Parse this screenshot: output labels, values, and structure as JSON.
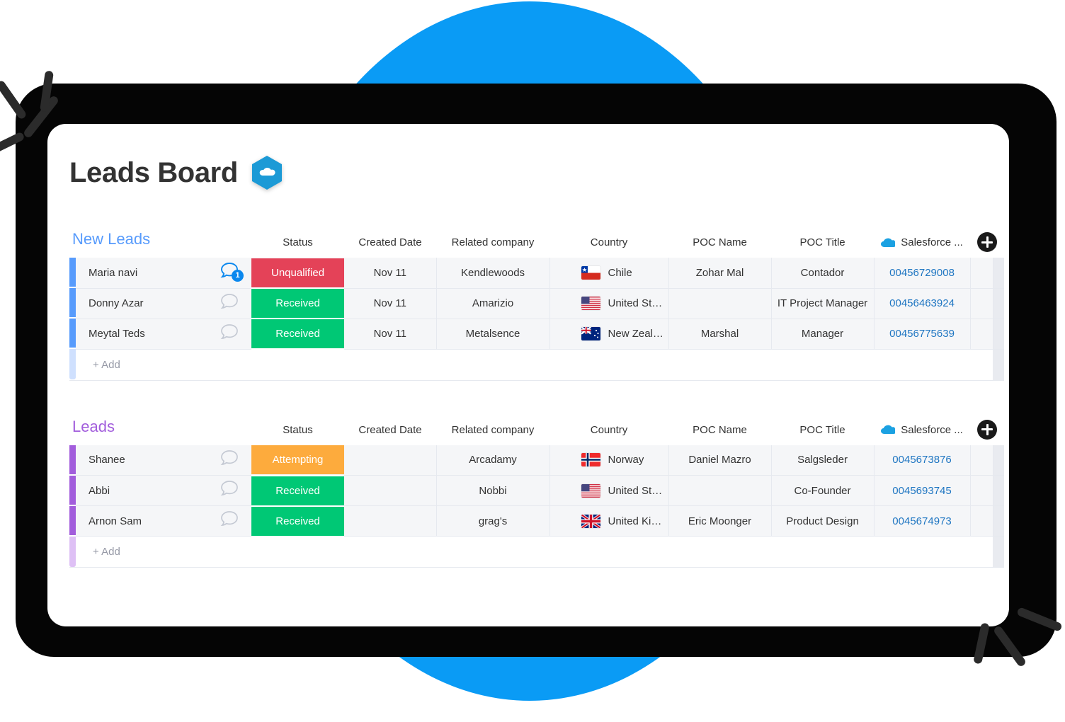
{
  "header": {
    "title": "Leads Board",
    "logo_icon": "salesforce-hexagon-cloud-icon"
  },
  "colors": {
    "background_circle": "#0a9bf5",
    "device_frame": "#050505",
    "card": "#ffffff",
    "group_new_leads": "#579bfc",
    "group_leads": "#a25ddc",
    "status_unqualified": "#e44258",
    "status_received": "#00c875",
    "status_attempting": "#fdab3d",
    "link": "#1f76c2"
  },
  "columns": [
    "Status",
    "Created Date",
    "Related company",
    "Country",
    "POC Name",
    "POC Title",
    "Salesforce ..."
  ],
  "add_row_label": "+ Add",
  "add_column_button": "add-column-button",
  "groups": [
    {
      "name": "New Leads",
      "accent": "#579bfc",
      "rows": [
        {
          "name": "Maria navi",
          "chat_count": "1",
          "status": "Unqualified",
          "status_color": "#e44258",
          "created_date": "Nov 11",
          "company": "Kendlewoods",
          "country": "Chile",
          "country_flag": "cl",
          "poc_name": "Zohar Mal",
          "poc_title": "Contador",
          "salesforce_id": "00456729008"
        },
        {
          "name": "Donny Azar",
          "chat_count": "",
          "status": "Received",
          "status_color": "#00c875",
          "created_date": "Nov 11",
          "company": "Amarizio",
          "country": "United States",
          "country_flag": "us",
          "poc_name": "",
          "poc_title": "IT Project Manager",
          "salesforce_id": "00456463924"
        },
        {
          "name": "Meytal Teds",
          "chat_count": "",
          "status": "Received",
          "status_color": "#00c875",
          "created_date": "Nov 11",
          "company": "Metalsence",
          "country": "New Zealand",
          "country_flag": "nz",
          "poc_name": "Marshal",
          "poc_title": "Manager",
          "salesforce_id": "00456775639"
        }
      ]
    },
    {
      "name": "Leads",
      "accent": "#a25ddc",
      "rows": [
        {
          "name": "Shanee",
          "chat_count": "",
          "status": "Attempting",
          "status_color": "#fdab3d",
          "created_date": "",
          "company": "Arcadamy",
          "country": "Norway",
          "country_flag": "no",
          "poc_name": "Daniel Mazro",
          "poc_title": "Salgsleder",
          "salesforce_id": "0045673876"
        },
        {
          "name": "Abbi",
          "chat_count": "",
          "status": "Received",
          "status_color": "#00c875",
          "created_date": "",
          "company": "Nobbi",
          "country": "United States",
          "country_flag": "us",
          "poc_name": "",
          "poc_title": "Co-Founder",
          "salesforce_id": "0045693745"
        },
        {
          "name": "Arnon Sam",
          "chat_count": "",
          "status": "Received",
          "status_color": "#00c875",
          "created_date": "",
          "company": "grag's",
          "country": "United Kingd…",
          "country_flag": "gb",
          "poc_name": "Eric Moonger",
          "poc_title": "Product Design",
          "salesforce_id": "0045674973"
        }
      ]
    }
  ]
}
